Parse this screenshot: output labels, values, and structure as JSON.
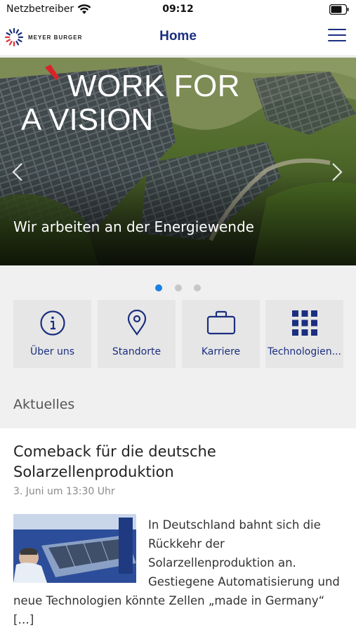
{
  "status_bar": {
    "carrier": "Netzbetreiber",
    "time": "09:12"
  },
  "nav": {
    "logo_text": "MEYER BURGER",
    "title": "Home"
  },
  "hero": {
    "headline_line1": "WORK FOR",
    "headline_line2": "A VISION",
    "caption": "Wir arbeiten an der Energiewende",
    "slide_count": 3,
    "active_slide": 1
  },
  "tiles": [
    {
      "label": "Über uns",
      "icon": "info-icon"
    },
    {
      "label": "Standorte",
      "icon": "location-pin-icon"
    },
    {
      "label": "Karriere",
      "icon": "briefcase-icon"
    },
    {
      "label": "Technologien...",
      "icon": "grid-icon"
    }
  ],
  "section_title": "Aktuelles",
  "article": {
    "title": "Comeback für die deutsche Solarzellenproduktion",
    "date": "3. Juni um 13:30 Uhr",
    "body": "In Deutschland bahnt sich die Rückkehr der Solarzellenproduktion an. Gestiegene Automatisierung und neue Technologien könnte Zellen „made in Germany“ […]"
  },
  "colors": {
    "brand_blue": "#1b2f80",
    "dot_active": "#1a7fe6",
    "tile_bg": "#e6e6e6"
  }
}
